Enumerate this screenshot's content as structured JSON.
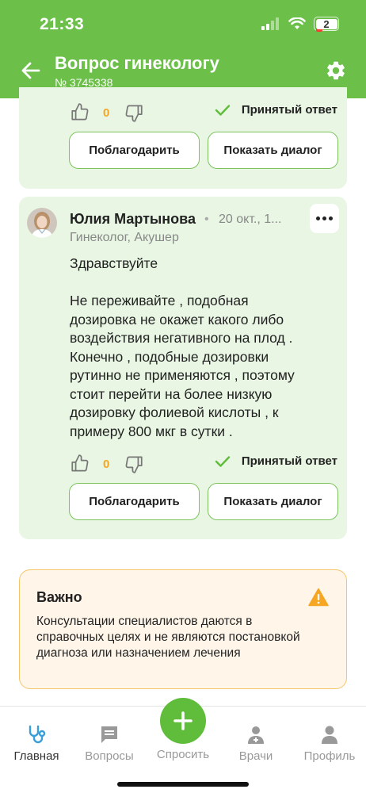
{
  "status_bar": {
    "time": "21:33",
    "battery": "2"
  },
  "header": {
    "title": "Вопрос гинекологу",
    "subtitle": "№ 3745338"
  },
  "answers": [
    {
      "votes": "0",
      "accepted_label": "Принятый ответ",
      "thank_label": "Поблагодарить",
      "dialog_label": "Показать диалог"
    },
    {
      "author": "Юлия Мартынова",
      "date": "20 окт., 1...",
      "role": "Гинеколог, Акушер",
      "message": "Здравствуйте\n\nНе переживайте , подобная дозировка не окажет какого либо воздействия негативного на плод .\nКонечно , подобные дозировки рутинно не применяются , поэтому стоит перейти на более низкую дозировку фолиевой кислоты , к примеру 800 мкг в сутки .",
      "votes": "0",
      "accepted_label": "Принятый ответ",
      "thank_label": "Поблагодарить",
      "dialog_label": "Показать диалог"
    }
  ],
  "important": {
    "title": "Важно",
    "text": "Консультации специалистов даются в справочных целях и не являются постановкой диагноза или назначением лечения"
  },
  "nav": {
    "home": "Главная",
    "questions": "Вопросы",
    "ask": "Спросить",
    "doctors": "Врачи",
    "profile": "Профиль"
  },
  "colors": {
    "brand": "#6cc04a",
    "card": "#e8f6e3",
    "votes": "#f5a623",
    "warning": "#f5a623"
  }
}
